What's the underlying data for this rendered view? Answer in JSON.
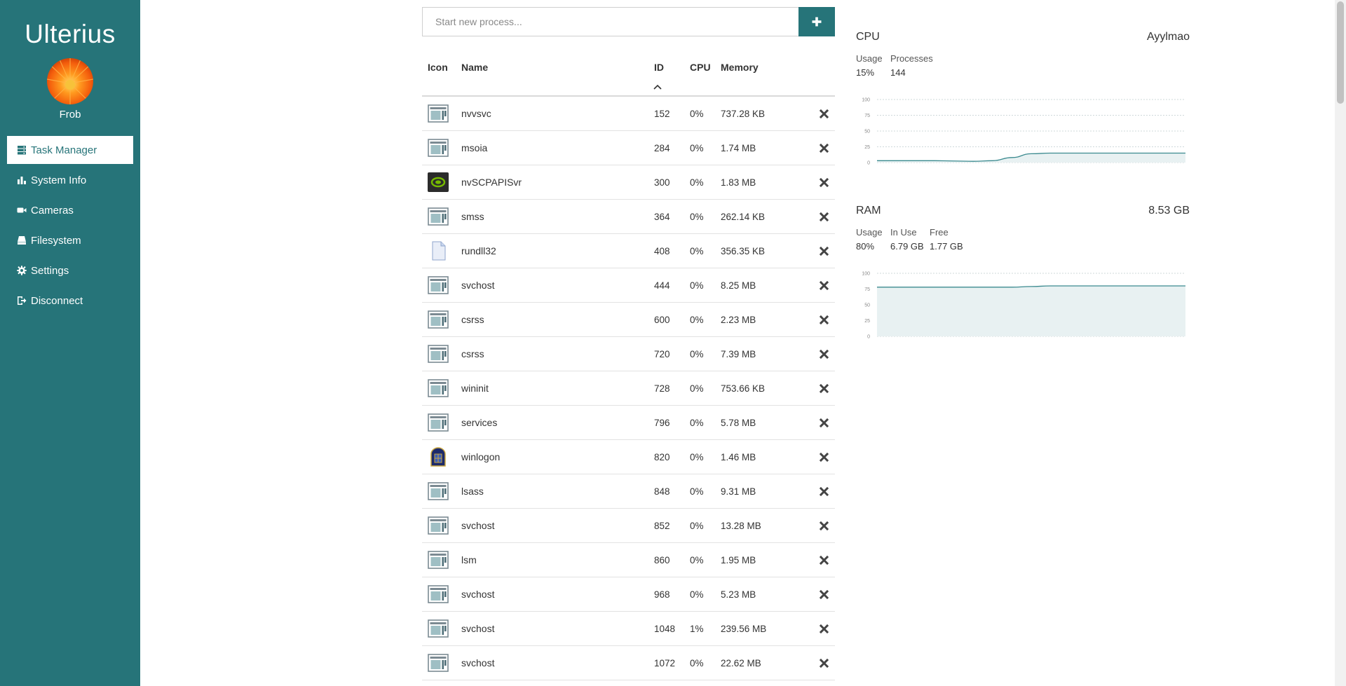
{
  "app": {
    "brand": "Ulterius",
    "username": "Frob"
  },
  "nav": [
    {
      "label": "Task Manager",
      "icon": "server-icon",
      "active": true
    },
    {
      "label": "System Info",
      "icon": "bar-chart-icon",
      "active": false
    },
    {
      "label": "Cameras",
      "icon": "video-camera-icon",
      "active": false
    },
    {
      "label": "Filesystem",
      "icon": "hard-drive-icon",
      "active": false
    },
    {
      "label": "Settings",
      "icon": "gear-icon",
      "active": false
    },
    {
      "label": "Disconnect",
      "icon": "sign-out-icon",
      "active": false
    }
  ],
  "process": {
    "placeholder": "Start new process...",
    "columns": {
      "icon": "Icon",
      "name": "Name",
      "id": "ID",
      "cpu": "CPU",
      "memory": "Memory"
    },
    "rows": [
      {
        "icon": "generic-app-icon",
        "name": "nvvsvc",
        "id": "152",
        "cpu": "0%",
        "memory": "737.28 KB"
      },
      {
        "icon": "generic-app-icon",
        "name": "msoia",
        "id": "284",
        "cpu": "0%",
        "memory": "1.74 MB"
      },
      {
        "icon": "nvidia-icon",
        "name": "nvSCPAPISvr",
        "id": "300",
        "cpu": "0%",
        "memory": "1.83 MB"
      },
      {
        "icon": "generic-app-icon",
        "name": "smss",
        "id": "364",
        "cpu": "0%",
        "memory": "262.14 KB"
      },
      {
        "icon": "document-icon",
        "name": "rundll32",
        "id": "408",
        "cpu": "0%",
        "memory": "356.35 KB"
      },
      {
        "icon": "generic-app-icon",
        "name": "svchost",
        "id": "444",
        "cpu": "0%",
        "memory": "8.25 MB"
      },
      {
        "icon": "generic-app-icon",
        "name": "csrss",
        "id": "600",
        "cpu": "0%",
        "memory": "2.23 MB"
      },
      {
        "icon": "generic-app-icon",
        "name": "csrss",
        "id": "720",
        "cpu": "0%",
        "memory": "7.39 MB"
      },
      {
        "icon": "generic-app-icon",
        "name": "wininit",
        "id": "728",
        "cpu": "0%",
        "memory": "753.66 KB"
      },
      {
        "icon": "generic-app-icon",
        "name": "services",
        "id": "796",
        "cpu": "0%",
        "memory": "5.78 MB"
      },
      {
        "icon": "winlogon-icon",
        "name": "winlogon",
        "id": "820",
        "cpu": "0%",
        "memory": "1.46 MB"
      },
      {
        "icon": "generic-app-icon",
        "name": "lsass",
        "id": "848",
        "cpu": "0%",
        "memory": "9.31 MB"
      },
      {
        "icon": "generic-app-icon",
        "name": "svchost",
        "id": "852",
        "cpu": "0%",
        "memory": "13.28 MB"
      },
      {
        "icon": "generic-app-icon",
        "name": "lsm",
        "id": "860",
        "cpu": "0%",
        "memory": "1.95 MB"
      },
      {
        "icon": "generic-app-icon",
        "name": "svchost",
        "id": "968",
        "cpu": "0%",
        "memory": "5.23 MB"
      },
      {
        "icon": "generic-app-icon",
        "name": "svchost",
        "id": "1048",
        "cpu": "1%",
        "memory": "239.56 MB"
      },
      {
        "icon": "generic-app-icon",
        "name": "svchost",
        "id": "1072",
        "cpu": "0%",
        "memory": "22.62 MB"
      }
    ]
  },
  "cpu": {
    "title": "CPU",
    "machine": "Ayylmao",
    "usage_label": "Usage",
    "usage": "15%",
    "processes_label": "Processes",
    "processes": "144",
    "series_percent": [
      3,
      3,
      3,
      3,
      2.5,
      2,
      3,
      8,
      14,
      15,
      15,
      15,
      15,
      15,
      15,
      15,
      15
    ]
  },
  "ram": {
    "title": "RAM",
    "total": "8.53 GB",
    "usage_label": "Usage",
    "usage": "80%",
    "inuse_label": "In Use",
    "inuse": "6.79 GB",
    "free_label": "Free",
    "free": "1.77 GB",
    "series_percent": [
      78,
      78,
      78,
      78,
      78,
      78,
      78,
      78,
      79,
      80,
      80,
      80,
      80,
      80,
      80,
      80,
      80
    ]
  },
  "chart_axis_ticks": [
    "100",
    "75",
    "50",
    "25",
    "0"
  ],
  "colors": {
    "accent": "#267479",
    "chart_line": "#3b8a8f",
    "chart_fill": "#e8f1f2"
  }
}
